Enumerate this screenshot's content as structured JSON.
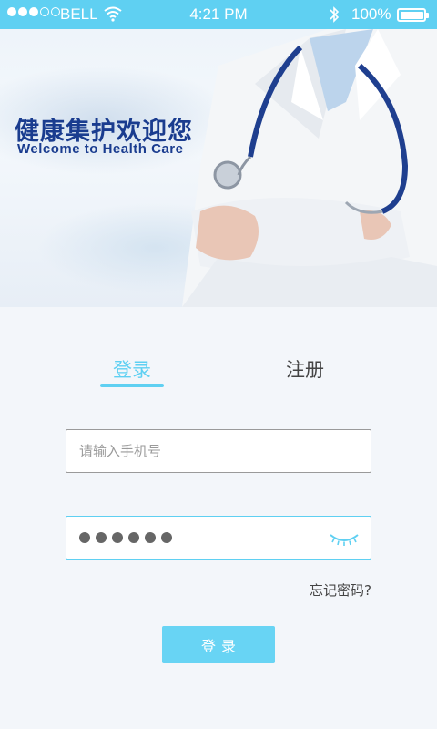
{
  "status_bar": {
    "carrier": "BELL",
    "time": "4:21 PM",
    "battery": "100%",
    "signal_strength": 3,
    "signal_max": 5,
    "battery_level": 1.0,
    "icons": [
      "signal-icon",
      "wifi-icon",
      "bluetooth-icon",
      "battery-icon"
    ]
  },
  "banner": {
    "title_cn": "健康集护欢迎您",
    "title_en": "Welcome to Health Care"
  },
  "tabs": [
    {
      "label": "登录",
      "active": true
    },
    {
      "label": "注册",
      "active": false
    }
  ],
  "form": {
    "phone_placeholder": "请输入手机号",
    "phone_value": "",
    "password_mask_length": 6,
    "show_password_icon": "eye-closed-icon",
    "forgot_label": "忘记密码?",
    "submit_label": "登录"
  },
  "colors": {
    "accent": "#5fd0f2",
    "title": "#1a3c8f",
    "button": "#68d4f4"
  }
}
